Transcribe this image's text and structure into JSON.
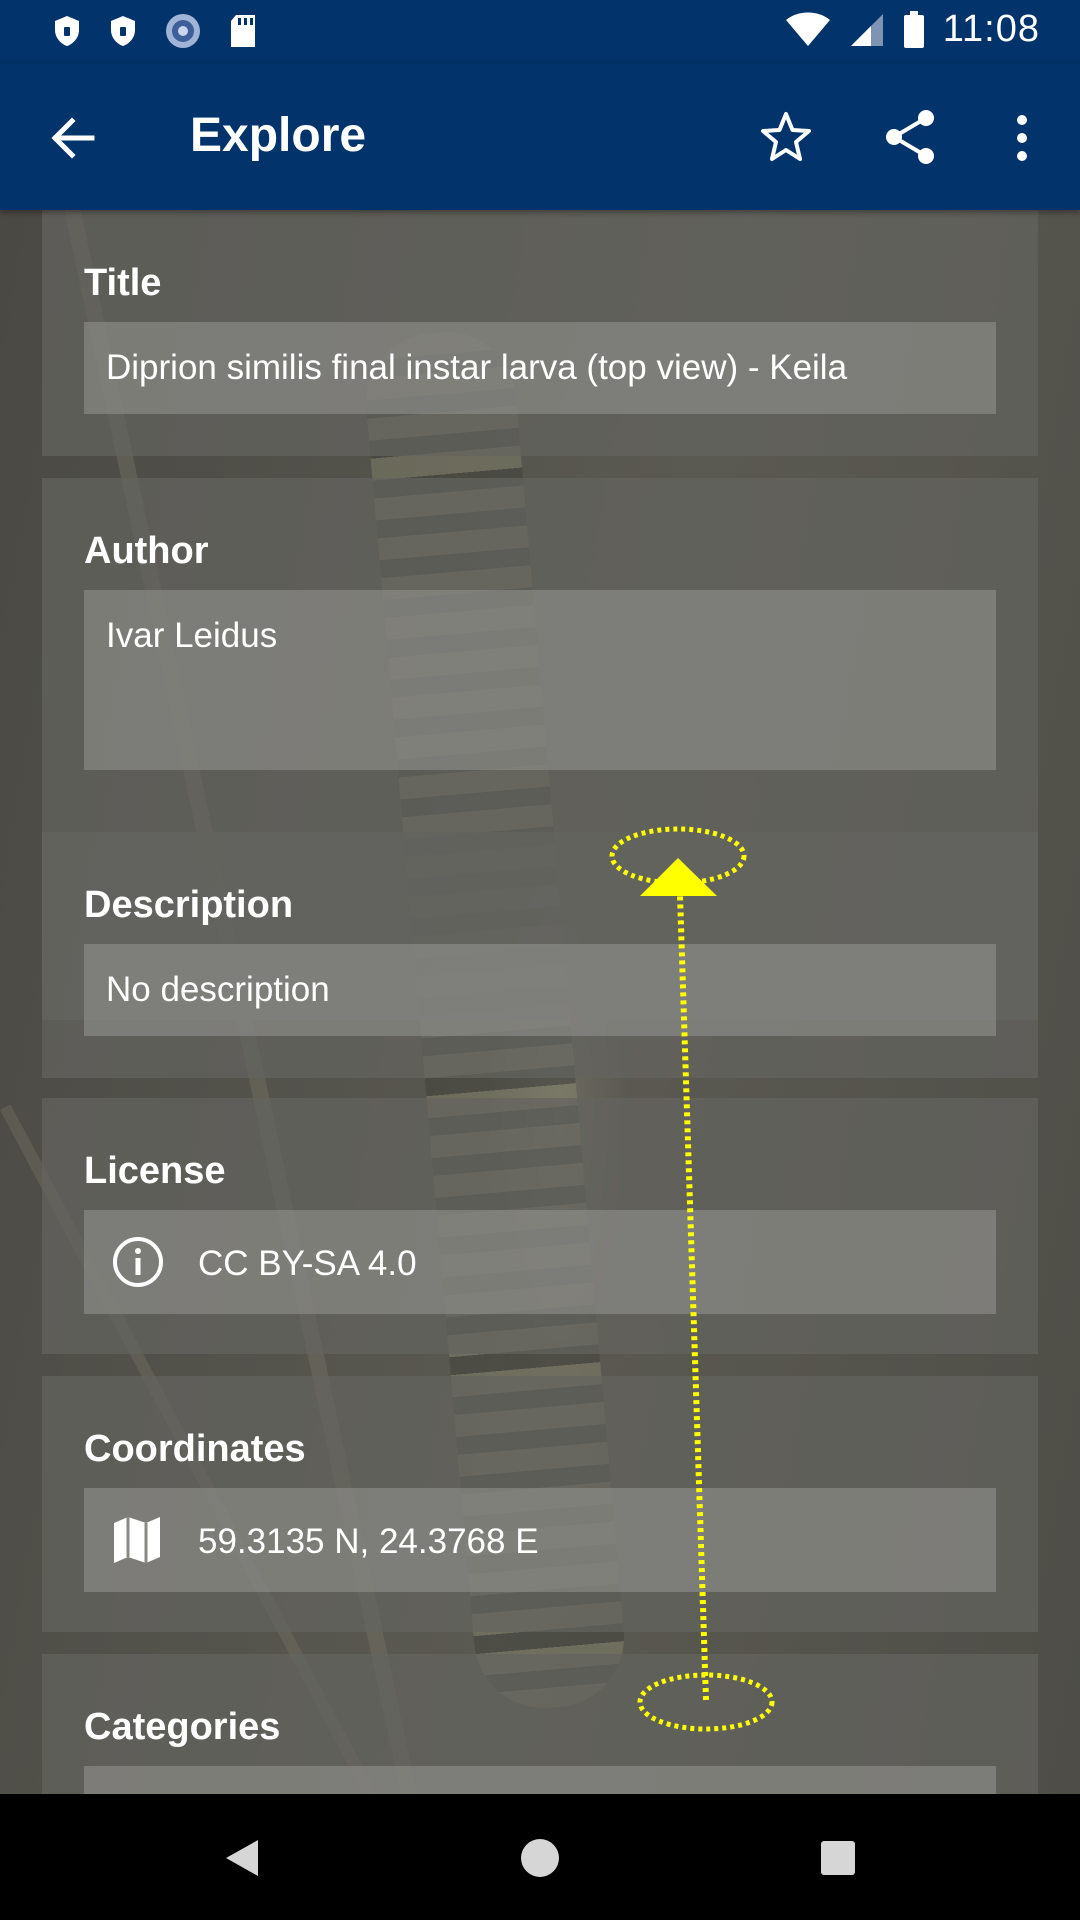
{
  "status_bar": {
    "time": "11:08",
    "icons": [
      "shield-icon",
      "shield-icon",
      "app-circle-icon",
      "sd-card-icon",
      "wifi-icon",
      "signal-icon",
      "battery-icon"
    ]
  },
  "app_bar": {
    "title": "Explore",
    "back_icon": "arrow-back-icon",
    "actions": [
      "star-icon",
      "share-icon",
      "more-vert-icon"
    ]
  },
  "fields": {
    "title": {
      "label": "Title",
      "value": "Diprion similis final instar larva (top view) - Keila"
    },
    "author": {
      "label": "Author",
      "value": "Ivar Leidus"
    },
    "description": {
      "label": "Description",
      "value": "No description"
    },
    "license": {
      "label": "License",
      "value": "CC BY-SA 4.0",
      "icon": "info-icon"
    },
    "coordinates": {
      "label": "Coordinates",
      "value": "59.3135 N, 24.3768 E",
      "icon": "map-icon"
    },
    "categories": {
      "label": "Categories"
    }
  },
  "gesture_overlay": {
    "type": "swipe-up",
    "color": "#ffff00"
  },
  "nav_bar": {
    "buttons": [
      "back-triangle-icon",
      "home-circle-icon",
      "recents-square-icon"
    ]
  }
}
